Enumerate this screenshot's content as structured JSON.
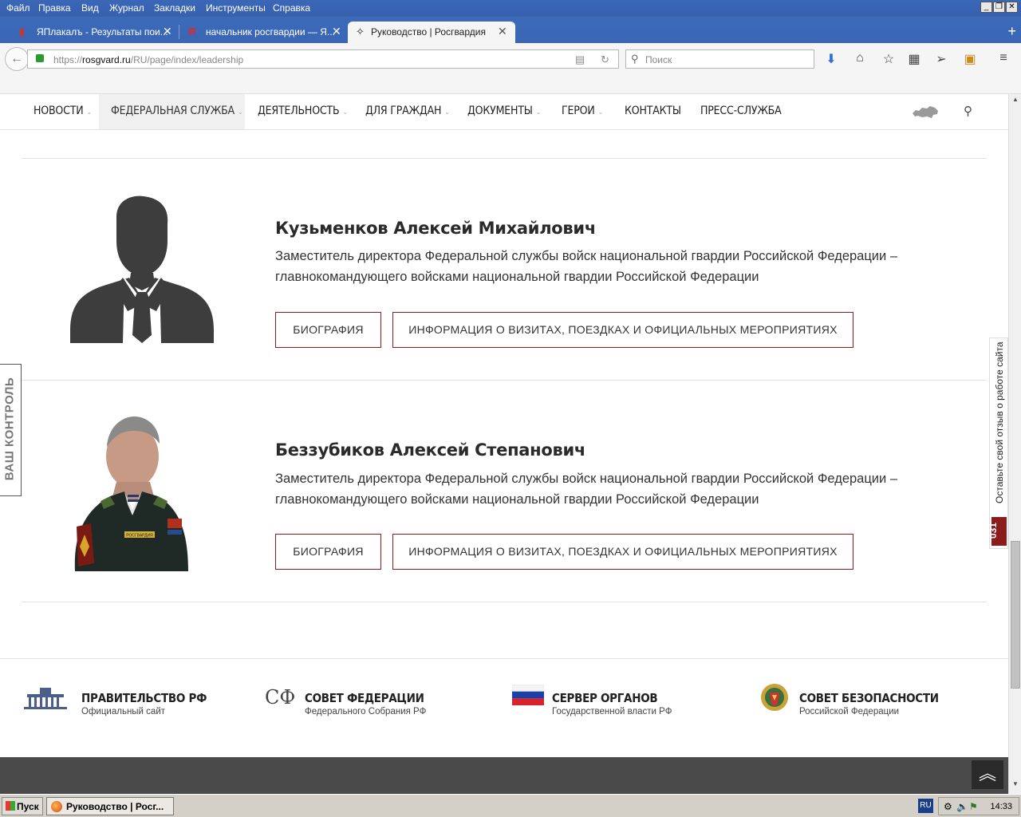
{
  "browser": {
    "menu": [
      "Файл",
      "Правка",
      "Вид",
      "Журнал",
      "Закладки",
      "Инструменты",
      "Справка"
    ],
    "tabs": [
      {
        "title": "ЯПлакалъ - Результаты пои..."
      },
      {
        "title": "начальник росгвардии — Я..."
      },
      {
        "title": "Руководство | Росгвардия"
      }
    ],
    "url_prefix": "https://",
    "url_host": "rosgvard.ru",
    "url_path": "/RU/page/index/leadership",
    "search_placeholder": "Поиск"
  },
  "site_nav": {
    "items": [
      {
        "label": "НОВОСТИ"
      },
      {
        "label": "ФЕДЕРАЛЬНАЯ СЛУЖБА"
      },
      {
        "label": "ДЕЯТЕЛЬНОСТЬ"
      },
      {
        "label": "ДЛЯ ГРАЖДАН"
      },
      {
        "label": "ДОКУМЕНТЫ"
      },
      {
        "label": "ГЕРОИ"
      },
      {
        "label": "КОНТАКТЫ"
      },
      {
        "label": "ПРЕСС-СЛУЖБА"
      }
    ]
  },
  "leaders": [
    {
      "name": "Кузьменков Алексей Михайлович",
      "title": "Заместитель директора Федеральной службы войск национальной гвардии Российской Федерации – главнокомандующего войсками национальной гвардии Российской Федерации",
      "bio_button": "БИОГРАФИЯ",
      "visits_button": "ИНФОРМАЦИЯ О ВИЗИТАХ, ПОЕЗДКАХ И ОФИЦИАЛЬНЫХ МЕРОПРИЯТИЯХ"
    },
    {
      "name": "Беззубиков Алексей Степанович",
      "title": "Заместитель директора Федеральной службы войск национальной гвардии Российской Федерации – главнокомандующего войсками национальной гвардии Российской Федерации",
      "bio_button": "БИОГРАФИЯ",
      "visits_button": "ИНФОРМАЦИЯ О ВИЗИТАХ, ПОЕЗДКАХ И ОФИЦИАЛЬНЫХ МЕРОПРИЯТИЯХ",
      "photo_badge_text": "РОСГВАРДИЯ"
    }
  ],
  "footer_links": [
    {
      "title": "ПРАВИТЕЛЬСТВО РФ",
      "subtitle": "Официальный сайт"
    },
    {
      "title": "СОВЕТ ФЕДЕРАЦИИ",
      "subtitle": "Федерального Собрания РФ",
      "logo_text": "СФ"
    },
    {
      "title": "СЕРВЕР ОРГАНОВ",
      "subtitle": "Государственной власти РФ"
    },
    {
      "title": "СОВЕТ БЕЗОПАСНОСТИ",
      "subtitle": "Российской Федерации"
    }
  ],
  "side_widgets": {
    "vash_kontrol": "ВАШ КОНТРОЛЬ",
    "feedback": "Оставьте свой отзыв о работе сайта",
    "feedback_badge": "031"
  },
  "taskbar": {
    "start": "Пуск",
    "window": "Руководство | Росг...",
    "lang": "RU",
    "time": "14:33"
  },
  "colors": {
    "accent": "#8b1c1c",
    "titlebar": "#3a67b8",
    "footer_dark": "#4a4a4a"
  }
}
